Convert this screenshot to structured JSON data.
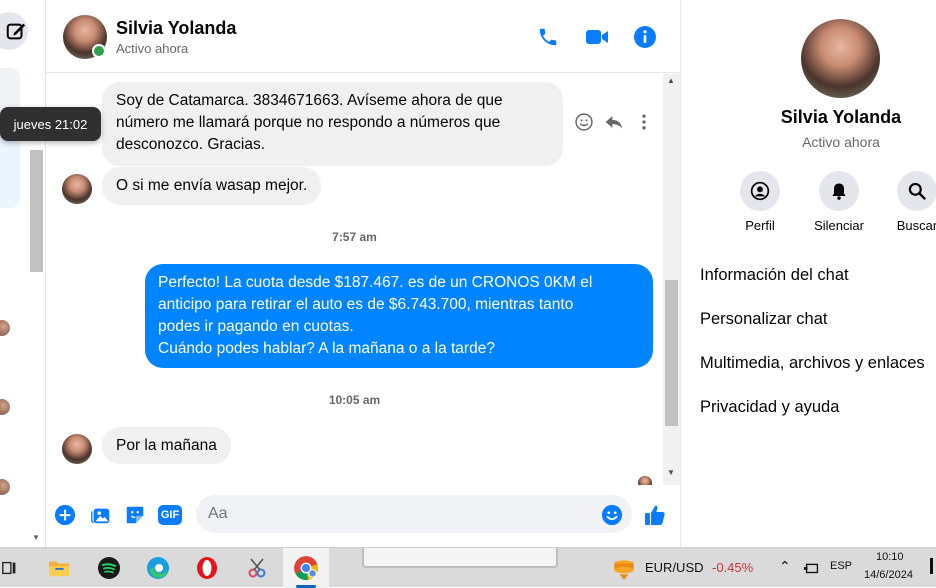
{
  "tooltip": {
    "text": "jueves 21:02"
  },
  "header": {
    "name": "Silvia Yolanda",
    "status": "Activo ahora"
  },
  "messages": {
    "msg1": [
      "Soy de Catamarca. 3834671663. Avíseme ahora de que",
      "número me llamará porque no respondo a números que",
      "desconozco.  Gracias."
    ],
    "msg2": "O si me envía wasap mejor.",
    "time1": "7:57 am",
    "msg3": [
      "Perfecto! La cuota desde $187.467. es de un CRONOS 0KM el",
      "anticipo para retirar el auto es de $6.743.700, mientras tanto",
      "podes ir pagando en cuotas.",
      "Cuándo podes hablar? A la mañana o a la tarde?"
    ],
    "time2": "10:05 am",
    "msg4": "Por la mañana"
  },
  "composer": {
    "placeholder": "Aa",
    "gif_label": "GIF"
  },
  "right_panel": {
    "name": "Silvia Yolanda",
    "status": "Activo ahora",
    "actions": [
      {
        "label": "Perfil",
        "icon": "profile-icon"
      },
      {
        "label": "Silenciar",
        "icon": "bell-icon"
      },
      {
        "label": "Buscar",
        "icon": "search-icon"
      }
    ],
    "menu": [
      "Información del chat",
      "Personalizar chat",
      "Multimedia, archivos y enlaces",
      "Privacidad y ayuda"
    ]
  },
  "taskbar": {
    "ticker_pair": "EUR/USD",
    "ticker_change": "-0.45%",
    "language": "ESP",
    "time": "10:10",
    "date": "14/6/2024",
    "apps": [
      "task-view-icon",
      "file-explorer-icon",
      "spotify-icon",
      "edge-icon",
      "opera-icon",
      "snipping-tool-icon",
      "chrome-icon"
    ]
  },
  "colors": {
    "accent": "#0084ff",
    "icon_blue": "#0a7cff",
    "online": "#31a24c",
    "ticker_negative": "#d13438"
  }
}
